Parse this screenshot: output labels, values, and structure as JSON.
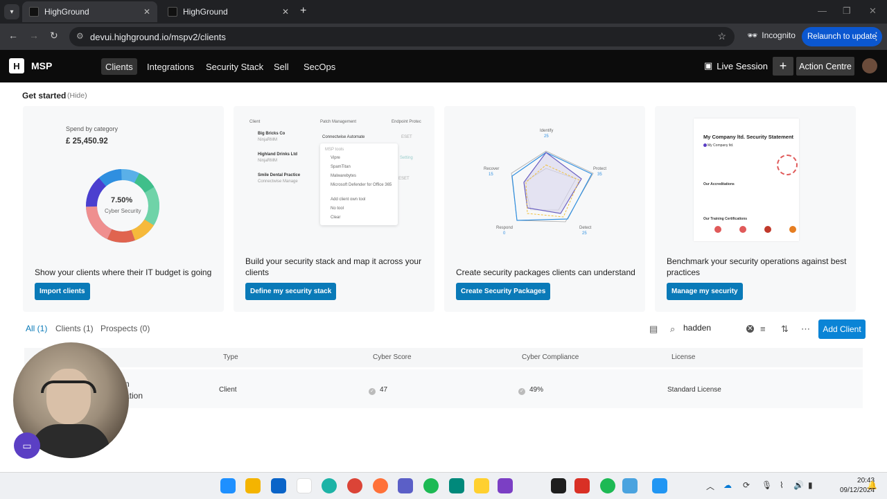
{
  "browser": {
    "tabs": [
      {
        "title": "HighGround",
        "active": true
      },
      {
        "title": "HighGround",
        "active": false
      }
    ],
    "url": "devui.highground.io/mspv2/clients",
    "incognito_label": "Incognito",
    "relaunch_label": "Relaunch to update"
  },
  "header": {
    "brand": "MSP",
    "nav": [
      "Clients",
      "Integrations",
      "Security Stack",
      "Sell",
      "SecOps"
    ],
    "active_nav": "Clients",
    "live_session": "Live Session",
    "action_centre": "Action Centre"
  },
  "get_started": {
    "title": "Get started",
    "hide_label": "(Hide)",
    "cards": [
      {
        "text": "Show your clients where their IT budget is going",
        "button": "Import clients",
        "preview": {
          "label": "Spend by category",
          "amount": "£ 25,450.92",
          "donut_value": "7.50%",
          "donut_label": "Cyber Security"
        }
      },
      {
        "text": "Build your security stack and map it across your clients",
        "button": "Define my security stack",
        "preview": {
          "col_headers": [
            "Client",
            "Patch Management",
            "Endpoint Protec"
          ],
          "rows": [
            {
              "name": "Big Bricks Co",
              "sub": "NinjaRMM"
            },
            {
              "name": "Highland Drinks Ltd",
              "sub": "NinjaRMM"
            },
            {
              "name": "Smile Dental Practice",
              "sub": "Connectwise Manage"
            }
          ],
          "selected_tool": "Connectwise Automate",
          "menu_header": "MSP tools",
          "menu_items": [
            "Vipre",
            "SpamTitan",
            "Malwarebytes",
            "Microsoft Defender for Office 365"
          ],
          "menu_actions": [
            "Add client own tool",
            "No tool",
            "Clear"
          ],
          "side_tags": [
            "ESET",
            "Setting",
            "ESET"
          ]
        }
      },
      {
        "text": "Create security packages clients can understand",
        "button": "Create Security Packages",
        "preview": {
          "axes": [
            {
              "label": "Identify",
              "value": "25"
            },
            {
              "label": "Protect",
              "value": "35"
            },
            {
              "label": "Detect",
              "value": "25"
            },
            {
              "label": "Respond",
              "value": "0"
            },
            {
              "label": "Recover",
              "value": "15"
            }
          ]
        }
      },
      {
        "text": "Benchmark your security operations against best practices",
        "button": "Manage my security",
        "preview": {
          "title": "My Company ltd. Security Statement",
          "company": "My Company ltd.",
          "section1": "Our Accreditations",
          "section2": "Our Training Certifications"
        }
      }
    ]
  },
  "filters": [
    {
      "label": "All (1)",
      "active": true
    },
    {
      "label": "Clients (1)",
      "active": false
    },
    {
      "label": "Prospects (0)",
      "active": false
    }
  ],
  "search": {
    "value": "hadden"
  },
  "add_client": "Add Client",
  "table": {
    "columns": [
      "Type",
      "Cyber Score",
      "Cyber Compliance",
      "License"
    ],
    "rows": [
      {
        "name_fragment_1": "n",
        "name_fragment_2": "ation",
        "type": "Client",
        "cyber_score": "47",
        "cyber_compliance": "49%",
        "license": "Standard License"
      }
    ]
  },
  "taskbar": {
    "time": "20:43",
    "date": "09/12/2024",
    "icons": [
      "windows-icon",
      "file-explorer-icon",
      "outlook-icon",
      "slack-icon",
      "edge-icon",
      "chrome-icon",
      "firefox-icon",
      "teams-icon",
      "spotify-icon",
      "meet-icon",
      "miro-icon",
      "loop-icon",
      "figma-icon",
      "acrobat-icon",
      "spotify-2-icon",
      "notepad-icon",
      "settings-icon"
    ]
  },
  "colors": {
    "accent": "#0a7ab8",
    "header_bg": "#0c0c0c",
    "add_client": "#0a84d6"
  }
}
